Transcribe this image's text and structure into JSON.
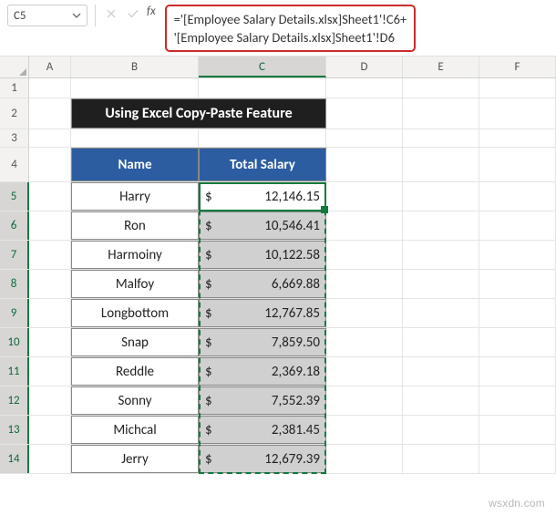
{
  "toolbar": {
    "namebox": "C5",
    "formula_line1": "='[Employee Salary Details.xlsx]Sheet1'!C6+",
    "formula_line2": "'[Employee Salary Details.xlsx]Sheet1'!D6"
  },
  "columns": [
    "A",
    "B",
    "C",
    "D",
    "E",
    "F"
  ],
  "row_numbers": [
    "1",
    "2",
    "3",
    "4",
    "5",
    "6",
    "7",
    "8",
    "9",
    "10",
    "11",
    "12",
    "13",
    "14"
  ],
  "title": "Using Excel Copy-Paste Feature",
  "headers": {
    "name": "Name",
    "salary": "Total Salary"
  },
  "currency": "$",
  "rows": [
    {
      "name": "Harry",
      "salary": "12,146.15"
    },
    {
      "name": "Ron",
      "salary": "10,546.41"
    },
    {
      "name": "Harmoiny",
      "salary": "10,122.58"
    },
    {
      "name": "Malfoy",
      "salary": "6,669.88"
    },
    {
      "name": "Longbottom",
      "salary": "12,767.85"
    },
    {
      "name": "Snap",
      "salary": "7,859.50"
    },
    {
      "name": "Reddle",
      "salary": "2,369.18"
    },
    {
      "name": "Sonny",
      "salary": "7,552.39"
    },
    {
      "name": "Michcal",
      "salary": "2,381.45"
    },
    {
      "name": "Jerry",
      "salary": "12,679.39"
    }
  ],
  "watermark": "wsxdn.com",
  "chart_data": {
    "type": "table",
    "title": "Using Excel Copy-Paste Feature",
    "columns": [
      "Name",
      "Total Salary"
    ],
    "rows": [
      [
        "Harry",
        12146.15
      ],
      [
        "Ron",
        10546.41
      ],
      [
        "Harmoiny",
        10122.58
      ],
      [
        "Malfoy",
        6669.88
      ],
      [
        "Longbottom",
        12767.85
      ],
      [
        "Snap",
        7859.5
      ],
      [
        "Reddle",
        2369.18
      ],
      [
        "Sonny",
        7552.39
      ],
      [
        "Michcal",
        2381.45
      ],
      [
        "Jerry",
        12679.39
      ]
    ]
  }
}
